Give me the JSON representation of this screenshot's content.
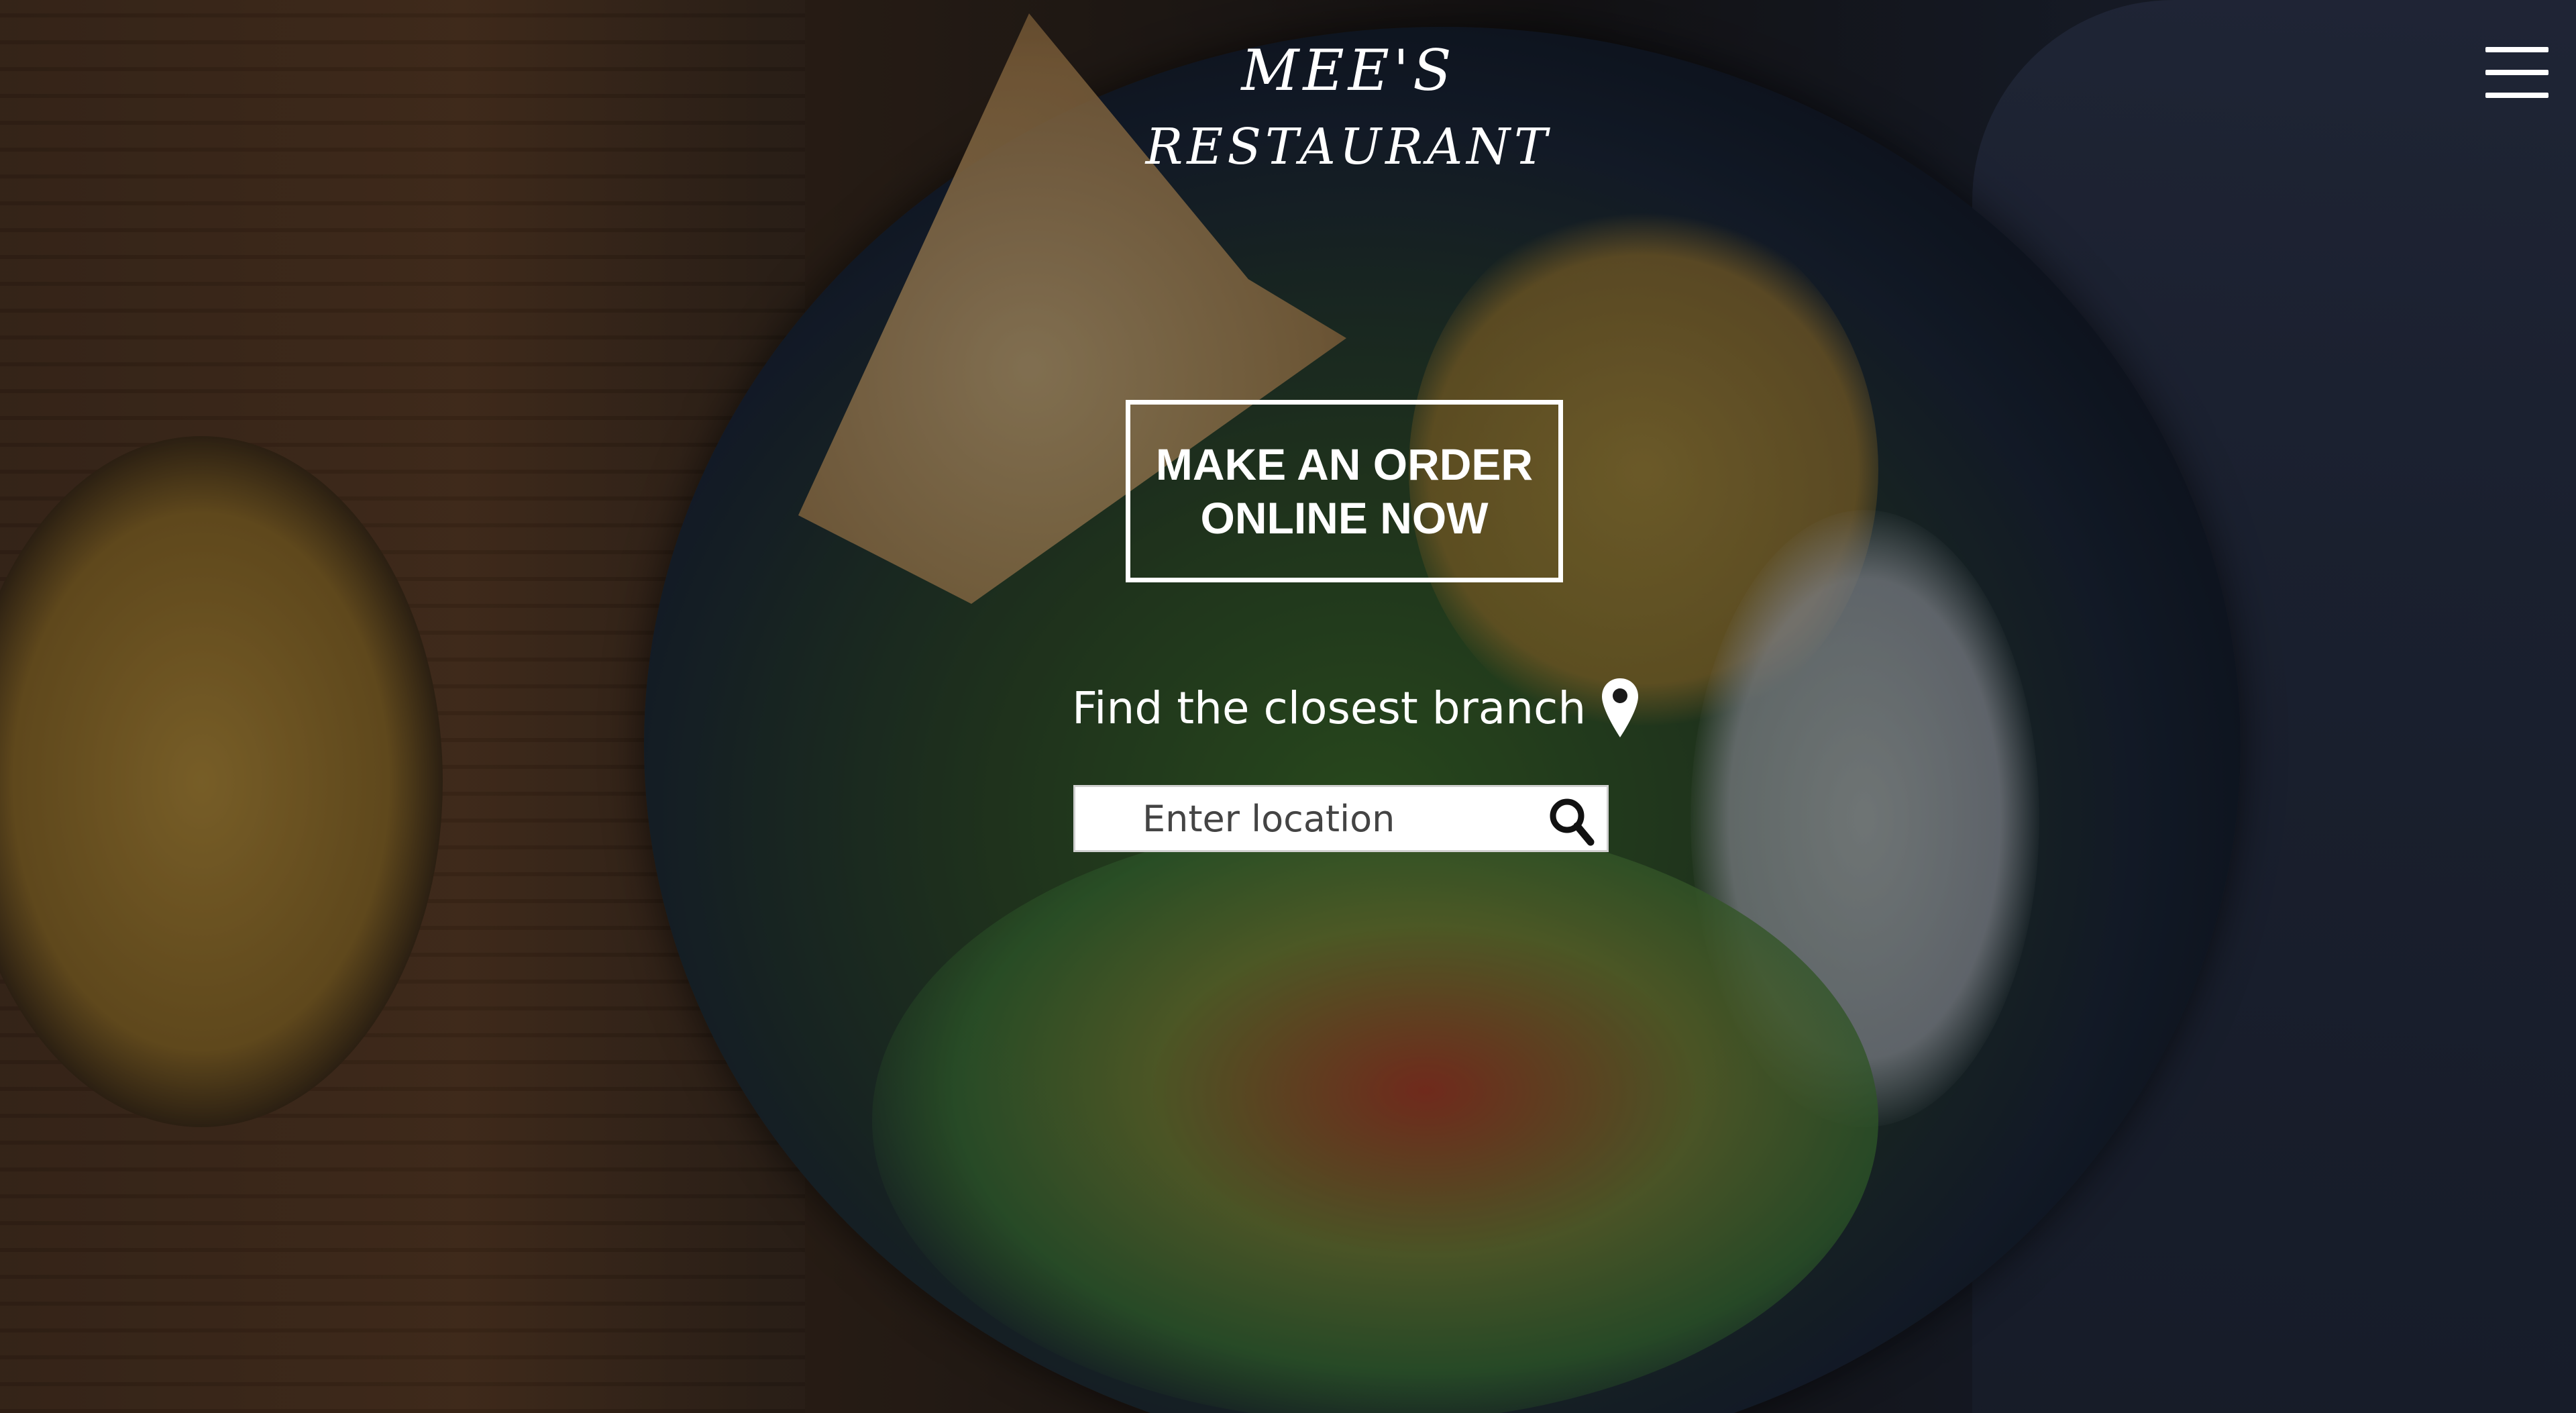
{
  "brand": {
    "line1": "MEE'S",
    "line2": "RESTAURANT"
  },
  "header": {
    "menu_icon": "hamburger-menu-icon"
  },
  "cta": {
    "line1": "MAKE AN ORDER",
    "line2": "ONLINE NOW"
  },
  "branch_finder": {
    "label": "Find the closest branch",
    "pin_icon": "location-pin-icon",
    "placeholder": "Enter location",
    "search_icon": "search-icon"
  },
  "colors": {
    "text": "#ffffff",
    "input_bg": "#ffffff",
    "icon_dark": "#111111"
  }
}
